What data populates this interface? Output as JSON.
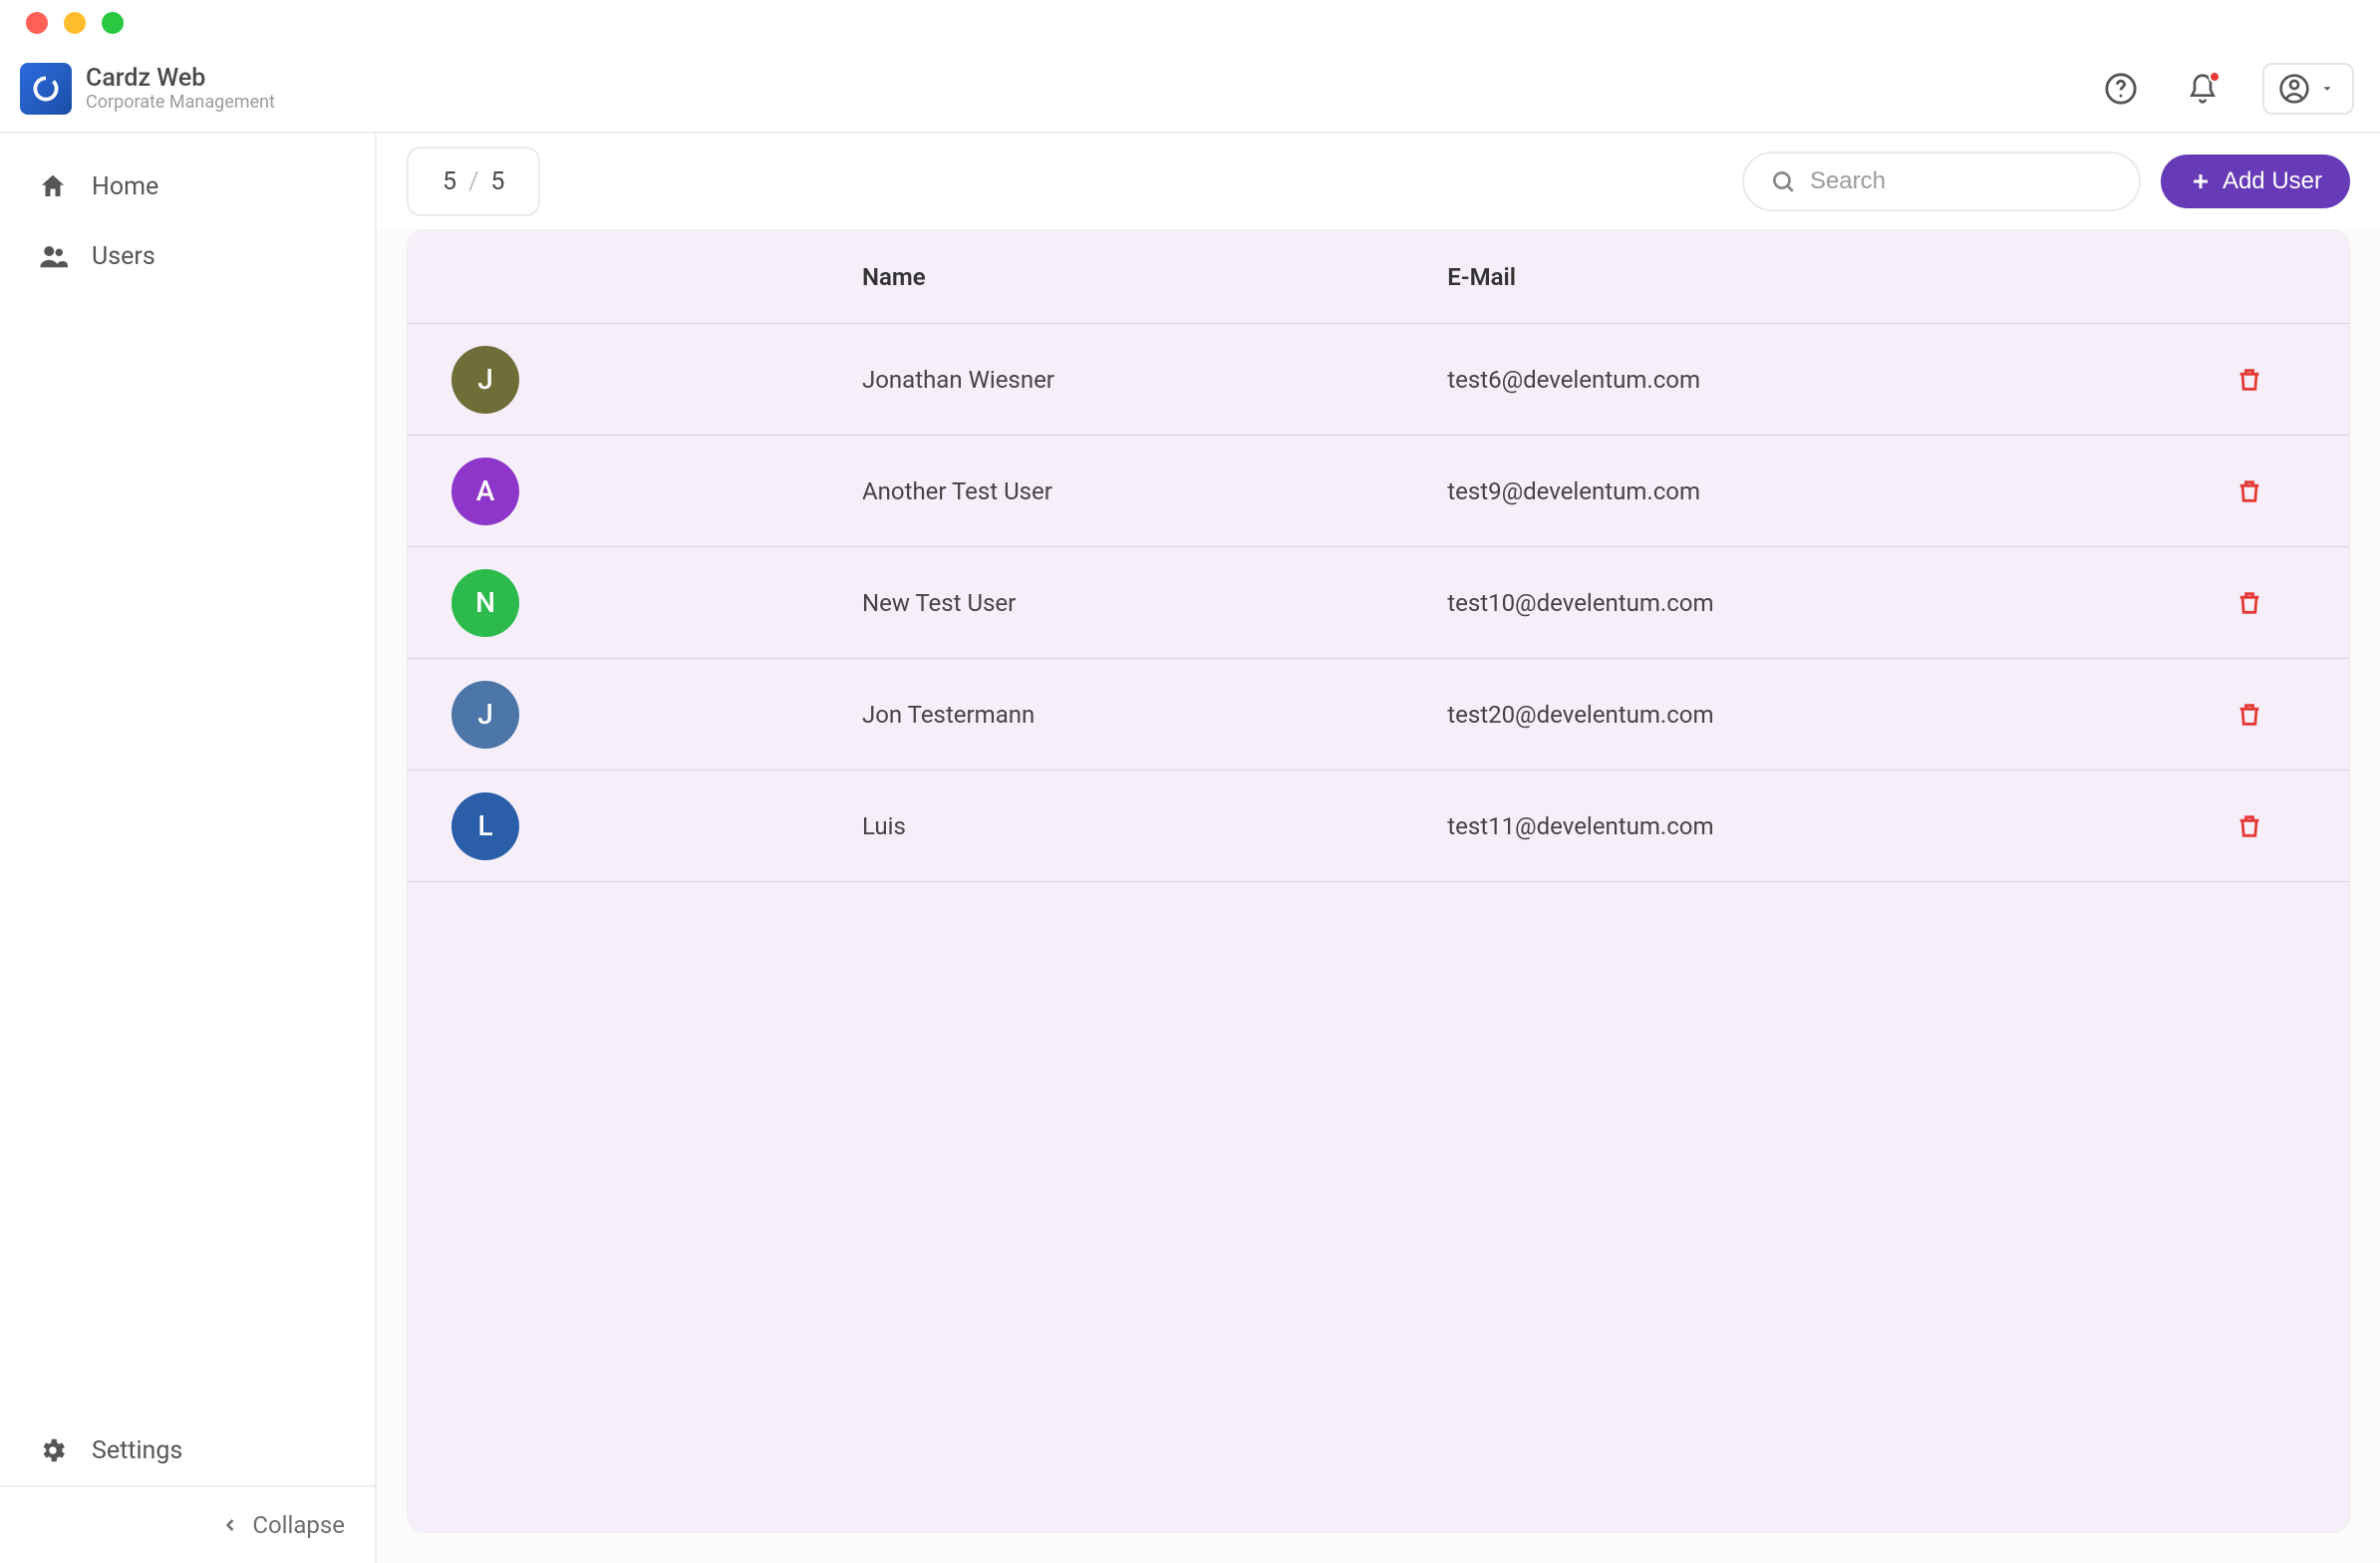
{
  "app": {
    "title": "Cardz Web",
    "subtitle": "Corporate Management"
  },
  "sidebar": {
    "items": [
      {
        "label": "Home"
      },
      {
        "label": "Users"
      }
    ],
    "settings_label": "Settings",
    "collapse_label": "Collapse"
  },
  "toolbar": {
    "count_current": "5",
    "count_total": "5",
    "search_placeholder": "Search",
    "add_user_label": "Add User"
  },
  "table": {
    "headers": {
      "name": "Name",
      "email": "E-Mail"
    },
    "rows": [
      {
        "initial": "J",
        "color": "#6f6d38",
        "name": "Jonathan Wiesner",
        "email": "test6@develentum.com"
      },
      {
        "initial": "A",
        "color": "#8e36c9",
        "name": "Another Test User",
        "email": "test9@develentum.com"
      },
      {
        "initial": "N",
        "color": "#2cba4c",
        "name": "New Test User",
        "email": "test10@develentum.com"
      },
      {
        "initial": "J",
        "color": "#4c76a8",
        "name": "Jon Testermann",
        "email": "test20@develentum.com"
      },
      {
        "initial": "L",
        "color": "#2a5ea8",
        "name": "Luis",
        "email": "test11@develentum.com"
      }
    ]
  }
}
